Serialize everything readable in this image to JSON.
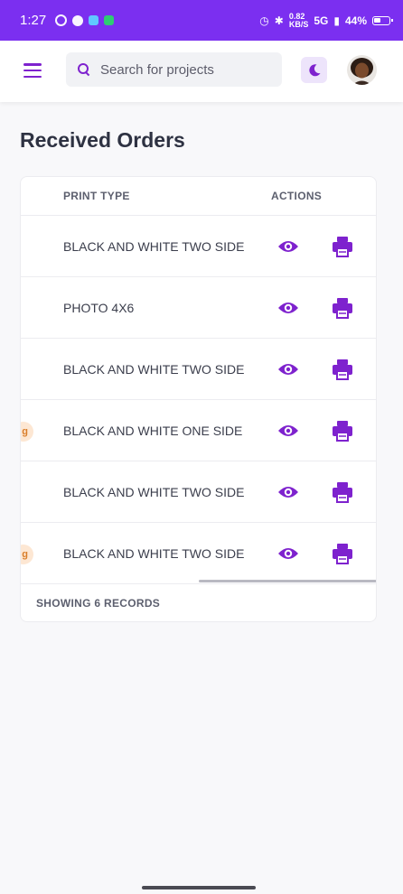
{
  "status_bar": {
    "time": "1:27",
    "speed_top": "0.82",
    "speed_bottom": "KB/S",
    "network": "5G",
    "battery": "44%"
  },
  "header": {
    "search": {
      "placeholder": "Search for projects"
    }
  },
  "page": {
    "title": "Received Orders"
  },
  "table": {
    "columns": {
      "print_type": "PRINT TYPE",
      "actions": "ACTIONS"
    },
    "rows": [
      {
        "print_type": "BLACK AND WHITE TWO SIDE",
        "badge": ""
      },
      {
        "print_type": "PHOTO 4X6",
        "badge": ""
      },
      {
        "print_type": "BLACK AND WHITE TWO SIDE",
        "badge": ""
      },
      {
        "print_type": "BLACK AND WHITE ONE SIDE",
        "badge": "g"
      },
      {
        "print_type": "BLACK AND WHITE TWO SIDE",
        "badge": ""
      },
      {
        "print_type": "BLACK AND WHITE TWO SIDE",
        "badge": "g"
      }
    ],
    "footer": "SHOWING 6 RECORDS"
  },
  "colors": {
    "accent": "#7e22ce",
    "status_bar": "#7b2ff0",
    "badge_bg": "#fde7d3",
    "badge_text": "#d97e2a"
  },
  "icons": {
    "menu": "hamburger-icon",
    "search": "search-icon",
    "theme": "moon-icon",
    "view": "eye-icon",
    "print": "printer-icon"
  }
}
